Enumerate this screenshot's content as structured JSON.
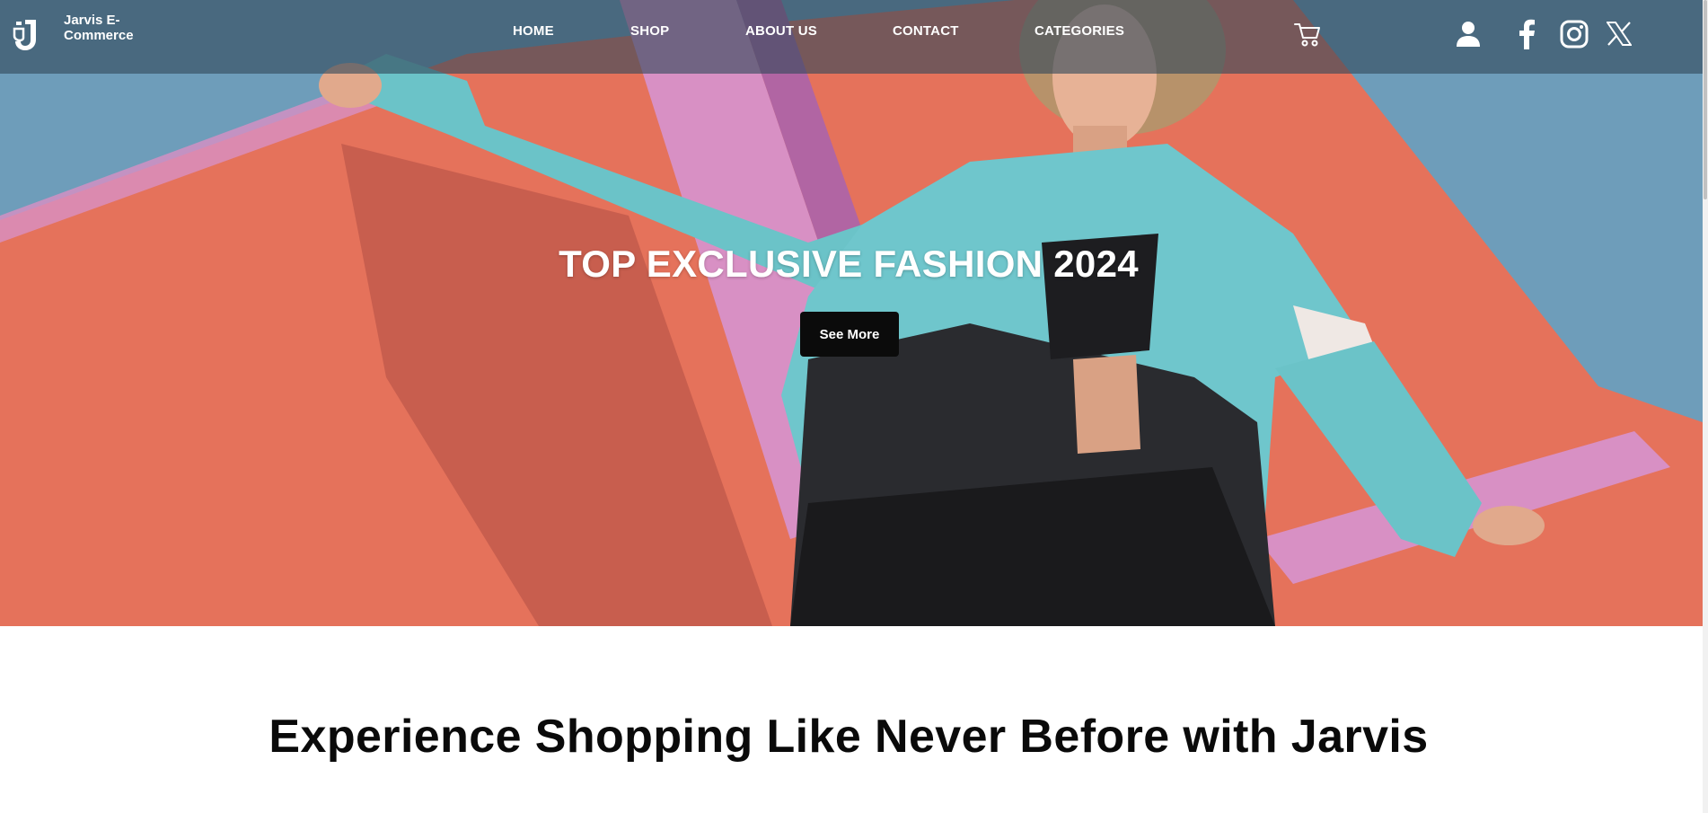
{
  "brand": {
    "name": "Jarvis E-Commerce",
    "logo_icon": "jarvis-j-logo-icon"
  },
  "nav": {
    "items": [
      {
        "label": "HOME"
      },
      {
        "label": "SHOP"
      },
      {
        "label": "ABOUT US"
      },
      {
        "label": "CONTACT"
      },
      {
        "label": "CATEGORIES"
      }
    ],
    "icons": [
      "cart-icon",
      "user-icon",
      "facebook-icon",
      "instagram-icon",
      "x-twitter-icon"
    ]
  },
  "hero": {
    "title": "TOP EXCLUSIVE FASHION 2024",
    "button_label": "See More",
    "image": "hero-fashion-photo"
  },
  "section": {
    "heading": "Experience Shopping Like Never Before with Jarvis"
  },
  "colors": {
    "nav_overlay": "#32485a",
    "hero_coral": "#e5725b",
    "hero_sky": "#6e9dba",
    "hero_pink": "#d890c4",
    "button_bg": "#0b0b0b",
    "heading_text": "#0a0a0a"
  }
}
